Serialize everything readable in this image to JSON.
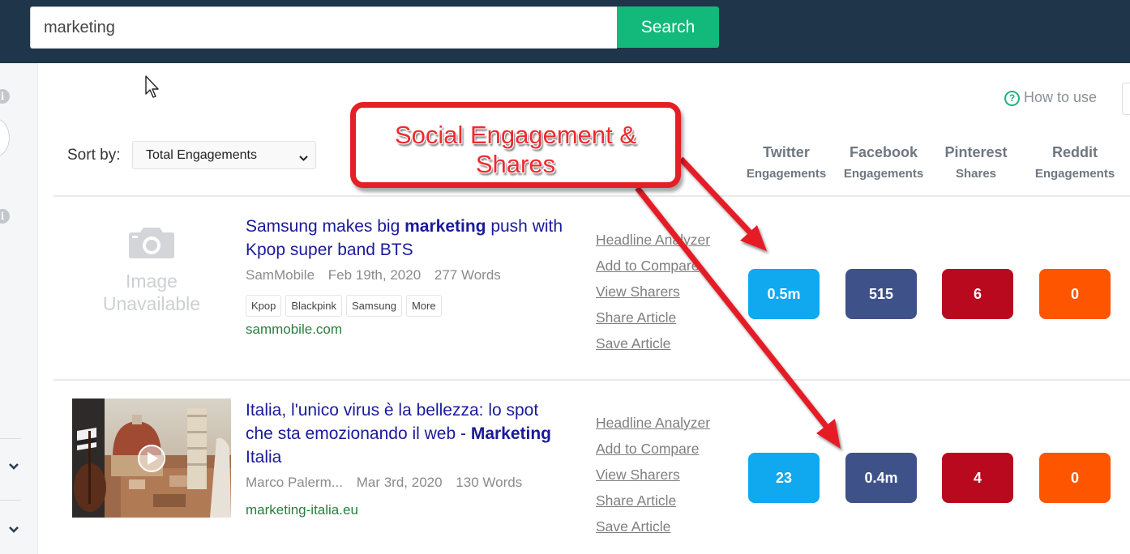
{
  "search": {
    "value": "marketing",
    "button": "Search"
  },
  "help": {
    "label": "How to use"
  },
  "sort": {
    "label": "Sort by:",
    "value": "Total Engagements"
  },
  "columns": [
    {
      "name": "Twitter",
      "sub": "Engagements"
    },
    {
      "name": "Facebook",
      "sub": "Engagements"
    },
    {
      "name": "Pinterest",
      "sub": "Shares"
    },
    {
      "name": "Reddit",
      "sub": "Engagements"
    }
  ],
  "callout": {
    "line1": "Social Engagement &",
    "line2": "Shares"
  },
  "image_unavailable": {
    "line1": "Image",
    "line2": "Unavailable"
  },
  "articles": [
    {
      "title_before": "Samsung makes big ",
      "title_bold": "marketing",
      "title_after": " push with Kpop super band BTS",
      "author": "SamMobile",
      "date": "Feb 19th, 2020",
      "words": "277 Words",
      "tags": [
        "Kpop",
        "Blackpink",
        "Samsung",
        "More"
      ],
      "domain": "sammobile.com",
      "metrics": {
        "twitter": "0.5m",
        "facebook": "515",
        "pinterest": "6",
        "reddit": "0"
      }
    },
    {
      "title_before": "Italia, l'unico virus è la bellezza: lo spot che sta emozionando il web - ",
      "title_bold": "Marketing",
      "title_after": " Italia",
      "author": "Marco Palerm...",
      "date": "Mar 3rd, 2020",
      "words": "130 Words",
      "domain": "marketing-italia.eu",
      "metrics": {
        "twitter": "23",
        "facebook": "0.4m",
        "pinterest": "4",
        "reddit": "0"
      }
    }
  ],
  "actions": [
    "Headline Analyzer",
    "Add to Compare",
    "View Sharers",
    "Share Article",
    "Save Article"
  ],
  "colors": {
    "topbar": "#1f3549",
    "search_button": "#13b97a",
    "twitter": "#10a8ef",
    "facebook": "#3f5189",
    "pinterest": "#b8091e",
    "reddit": "#fe5500",
    "annotation": "#e51f26"
  },
  "icons": [
    "info-icon",
    "chevron-down-icon",
    "camera-icon",
    "play-icon",
    "help-icon",
    "cursor-icon"
  ]
}
